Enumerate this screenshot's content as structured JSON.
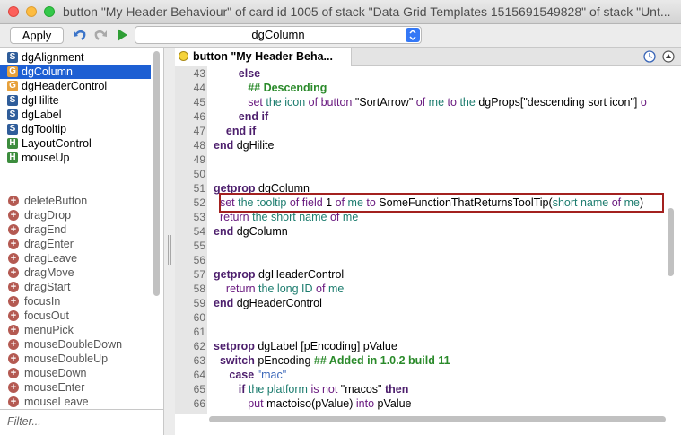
{
  "window": {
    "title": "button \"My Header Behaviour\" of card id 1005 of stack \"Data Grid Templates 1515691549828\" of stack \"Unt..."
  },
  "toolbar": {
    "apply_label": "Apply",
    "handler_select_value": "dgColumn"
  },
  "handlers": [
    {
      "badge": "S",
      "type": "S",
      "label": "dgAlignment",
      "selected": false
    },
    {
      "badge": "G",
      "type": "C",
      "label": "dgColumn",
      "selected": true
    },
    {
      "badge": "G",
      "type": "C",
      "label": "dgHeaderControl",
      "selected": false
    },
    {
      "badge": "S",
      "type": "S",
      "label": "dgHilite",
      "selected": false
    },
    {
      "badge": "S",
      "type": "S",
      "label": "dgLabel",
      "selected": false
    },
    {
      "badge": "S",
      "type": "S",
      "label": "dgTooltip",
      "selected": false
    },
    {
      "badge": "H",
      "type": "H",
      "label": "LayoutControl",
      "selected": false
    },
    {
      "badge": "H",
      "type": "H",
      "label": "mouseUp",
      "selected": false
    }
  ],
  "messages": [
    "deleteButton",
    "dragDrop",
    "dragEnd",
    "dragEnter",
    "dragLeave",
    "dragMove",
    "dragStart",
    "focusIn",
    "focusOut",
    "menuPick",
    "mouseDoubleDown",
    "mouseDoubleUp",
    "mouseDown",
    "mouseEnter",
    "mouseLeave"
  ],
  "filter": {
    "placeholder": "Filter..."
  },
  "editor": {
    "tab_label": "button \"My Header Beha...",
    "lines": [
      {
        "n": "43",
        "html": "        <span class=\"kw\">else</span>"
      },
      {
        "n": "44",
        "html": "           <span class=\"cm\">## Descending</span>"
      },
      {
        "n": "45",
        "html": "           <span class=\"kw2\">set</span> <span class=\"gr\">the</span> <span class=\"gr\">icon</span> <span class=\"kw2\">of</span> <span class=\"kw2\">button</span> \"SortArrow\" <span class=\"kw2\">of</span> <span class=\"gr\">me</span> <span class=\"kw2\">to</span> <span class=\"gr\">the</span> dgProps[\"descending sort icon\"] <span class=\"kw2\">o</span>"
      },
      {
        "n": "46",
        "html": "        <span class=\"kw\">end if</span>"
      },
      {
        "n": "47",
        "html": "    <span class=\"kw\">end if</span>"
      },
      {
        "n": "48",
        "html": "<span class=\"kw\">end</span> dgHilite"
      },
      {
        "n": "49",
        "html": ""
      },
      {
        "n": "50",
        "html": ""
      },
      {
        "n": "51",
        "html": "<span class=\"kw\">getprop</span> dgColumn"
      },
      {
        "n": "52",
        "html": "  <span class=\"kw2\">set</span> <span class=\"gr\">the</span> <span class=\"gr\">tooltip</span> <span class=\"kw2\">of</span> <span class=\"kw2\">field</span> 1 <span class=\"kw2\">of</span> <span class=\"gr\">me</span> <span class=\"kw2\">to</span> SomeFunctionThatReturnsToolTip(<span class=\"gr\">short name</span> <span class=\"kw2\">of</span> <span class=\"gr\">me</span>)"
      },
      {
        "n": "53",
        "html": "  <span class=\"kw2\">return</span> <span class=\"gr\">the</span> <span class=\"gr\">short name</span> <span class=\"kw2\">of</span> <span class=\"gr\">me</span>"
      },
      {
        "n": "54",
        "html": "<span class=\"kw\">end</span> dgColumn"
      },
      {
        "n": "55",
        "html": ""
      },
      {
        "n": "56",
        "html": ""
      },
      {
        "n": "57",
        "html": "<span class=\"kw\">getprop</span> dgHeaderControl"
      },
      {
        "n": "58",
        "html": "    <span class=\"kw2\">return</span> <span class=\"gr\">the</span> <span class=\"gr\">long ID</span> <span class=\"kw2\">of</span> <span class=\"gr\">me</span>"
      },
      {
        "n": "59",
        "html": "<span class=\"kw\">end</span> dgHeaderControl"
      },
      {
        "n": "60",
        "html": ""
      },
      {
        "n": "61",
        "html": ""
      },
      {
        "n": "62",
        "html": "<span class=\"kw\">setprop</span> dgLabel [pEncoding] pValue"
      },
      {
        "n": "63",
        "html": "  <span class=\"kw\">switch</span> pEncoding <span class=\"cm\">## Added in 1.0.2 build 11</span>"
      },
      {
        "n": "64",
        "html": "     <span class=\"kw\">case</span> <span class=\"st\">\"mac\"</span>"
      },
      {
        "n": "65",
        "html": "        <span class=\"kw\">if</span> <span class=\"gr\">the</span> <span class=\"gr\">platform</span> <span class=\"kw2\">is not</span> \"macos\" <span class=\"kw\">then</span>"
      },
      {
        "n": "66",
        "html": "           <span class=\"kw2\">put</span> mactoiso(pValue) <span class=\"kw2\">into</span> pValue"
      }
    ]
  }
}
